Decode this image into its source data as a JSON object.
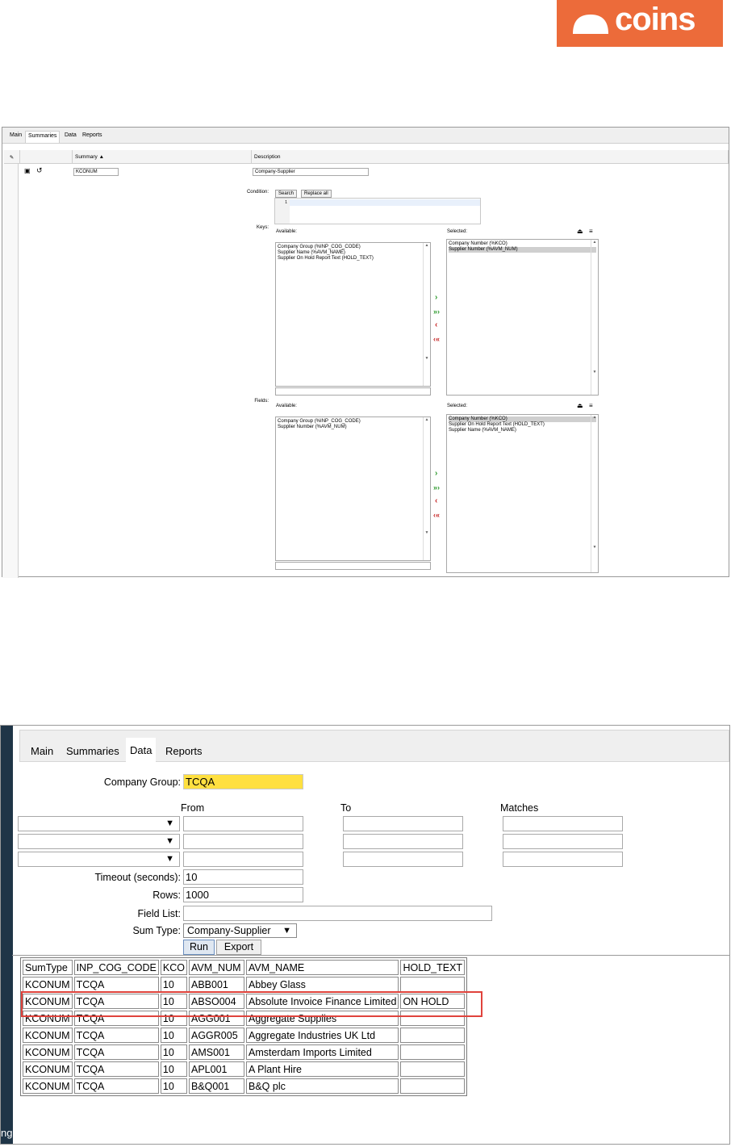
{
  "logo": {
    "text": "coins"
  },
  "summaries_view": {
    "tabs": [
      "Main",
      "Summaries",
      "Data",
      "Reports"
    ],
    "active_tab": "Summaries",
    "grid_headers": {
      "summary": "Summary ▲",
      "description": "Description"
    },
    "row": {
      "summary": "KCONUM",
      "description": "Company-Supplier"
    },
    "condition": {
      "label": "Condition:",
      "search": "Search",
      "replace_all": "Replace all",
      "line_number": "1"
    },
    "keys": {
      "label": "Keys:",
      "available_label": "Available:",
      "selected_label": "Selected:",
      "available": [
        "Company Group (%INP_COG_CODE)",
        "Supplier Name (%AVM_NAME)",
        "Supplier On Hold Report Text (HOLD_TEXT)"
      ],
      "selected": [
        "Company Number (%KCO)",
        "Supplier Number (%AVM_NUM)"
      ],
      "selected_highlight": 1
    },
    "fields": {
      "label": "Fields:",
      "available_label": "Available:",
      "selected_label": "Selected:",
      "available": [
        "Company Group (%INP_COG_CODE)",
        "Supplier Number (%AVM_NUM)"
      ],
      "selected": [
        "Company Number (%KCO)",
        "Supplier On Hold Report Text (HOLD_TEXT)",
        "Supplier Name (%AVM_NAME)"
      ],
      "selected_highlight": 0
    },
    "mover_icons": [
      "move-right-icon",
      "move-all-right-icon",
      "move-left-icon",
      "move-all-left-icon"
    ],
    "colors": {
      "add": "#2e9a2e",
      "remove": "#c62828"
    }
  },
  "data_view": {
    "side_text": "ng",
    "tabs": [
      "Main",
      "Summaries",
      "Data",
      "Reports"
    ],
    "active_tab": "Data",
    "company_group": {
      "label": "Company Group:",
      "value": "TCQA"
    },
    "range_headers": {
      "from": "From",
      "to": "To",
      "matches": "Matches"
    },
    "timeout": {
      "label": "Timeout (seconds):",
      "value": "10"
    },
    "rows": {
      "label": "Rows:",
      "value": "1000"
    },
    "field_list": {
      "label": "Field List:",
      "value": ""
    },
    "sum_type": {
      "label": "Sum Type:",
      "value": "Company-Supplier"
    },
    "buttons": {
      "run": "Run",
      "export": "Export"
    },
    "table": {
      "headers": [
        "SumType",
        "INP_COG_CODE",
        "KCO",
        "AVM_NUM",
        "AVM_NAME",
        "HOLD_TEXT"
      ],
      "rows": [
        [
          "KCONUM",
          "TCQA",
          "10",
          "ABB001",
          "Abbey Glass",
          ""
        ],
        [
          "KCONUM",
          "TCQA",
          "10",
          "ABSO004",
          "Absolute Invoice Finance Limited",
          "ON HOLD"
        ],
        [
          "KCONUM",
          "TCQA",
          "10",
          "AGG001",
          "Aggregate Supplies",
          ""
        ],
        [
          "KCONUM",
          "TCQA",
          "10",
          "AGGR005",
          "Aggregate Industries UK Ltd",
          ""
        ],
        [
          "KCONUM",
          "TCQA",
          "10",
          "AMS001",
          "Amsterdam Imports Limited",
          ""
        ],
        [
          "KCONUM",
          "TCQA",
          "10",
          "APL001",
          "A Plant Hire",
          ""
        ],
        [
          "KCONUM",
          "TCQA",
          "10",
          "B&Q001",
          "B&Q plc",
          ""
        ]
      ],
      "highlighted_row": 1,
      "highlight_color": "#e0433c"
    }
  }
}
